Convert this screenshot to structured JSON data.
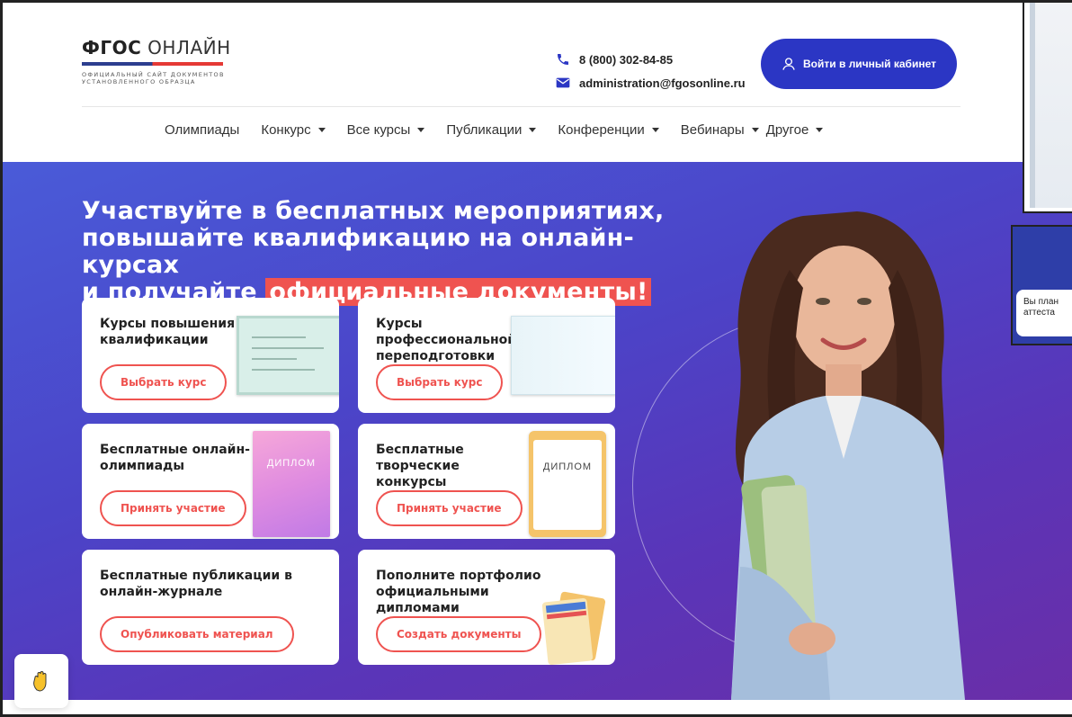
{
  "logo": {
    "bold": "ФГОС",
    "thin": "ОНЛАЙН",
    "subtitle_line1": "ОФИЦИАЛЬНЫЙ САЙТ ДОКУМЕНТОВ",
    "subtitle_line2": "УСТАНОВЛЕННОГО ОБРАЗЦА"
  },
  "contacts": {
    "phone": "8 (800) 302-84-85",
    "email": "administration@fgosonline.ru",
    "phone_icon": "phone-icon",
    "email_icon": "mail-icon"
  },
  "header": {
    "login_label": "Войти в личный кабинет",
    "login_icon": "user-icon"
  },
  "nav": {
    "items": [
      {
        "label": "Олимпиады",
        "dropdown": false
      },
      {
        "label": "Конкурс",
        "dropdown": true
      },
      {
        "label": "Все курсы",
        "dropdown": true
      },
      {
        "label": "Публикации",
        "dropdown": true
      },
      {
        "label": "Конференции",
        "dropdown": true
      },
      {
        "label": "Вебинары",
        "dropdown": true
      },
      {
        "label": "Другое",
        "dropdown": true
      }
    ]
  },
  "hero": {
    "title_line1": "Участвуйте в бесплатных мероприятиях,",
    "title_line2": "повышайте квалификацию на онлайн-курсах",
    "title_line3_prefix": "и получайте ",
    "title_highlight": "официальные документы!"
  },
  "cards": [
    {
      "title": "Курсы повышения квалификации",
      "button": "Выбрать курс"
    },
    {
      "title": "Курсы профессиональной переподготовки",
      "button": "Выбрать курс"
    },
    {
      "title": "Бесплатные онлайн-олимпиады",
      "button": "Принять участие",
      "badge": "ДИПЛОМ"
    },
    {
      "title": "Бесплатные творческие конкурсы",
      "button": "Принять участие",
      "badge": "ДИПЛОМ"
    },
    {
      "title": "Бесплатные публикации в онлайн-журнале",
      "button": "Опубликовать материал"
    },
    {
      "title": "Пополните портфолио официальными дипломами",
      "button": "Создать документы"
    }
  ],
  "side": {
    "tip_line1": "Вы план",
    "tip_line2": "аттеста"
  },
  "chat": {
    "icon": "waving-hand-icon"
  },
  "colors": {
    "accent": "#ef5350",
    "primary": "#2b36c4",
    "hero_start": "#4a5bd8",
    "hero_end": "#6a2ea8"
  }
}
